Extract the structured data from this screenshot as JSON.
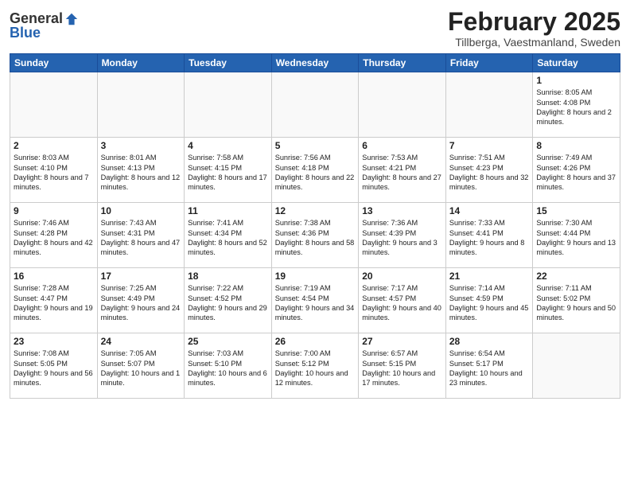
{
  "header": {
    "logo_general": "General",
    "logo_blue": "Blue",
    "month_title": "February 2025",
    "subtitle": "Tillberga, Vaestmanland, Sweden"
  },
  "weekdays": [
    "Sunday",
    "Monday",
    "Tuesday",
    "Wednesday",
    "Thursday",
    "Friday",
    "Saturday"
  ],
  "weeks": [
    [
      {
        "day": "",
        "info": ""
      },
      {
        "day": "",
        "info": ""
      },
      {
        "day": "",
        "info": ""
      },
      {
        "day": "",
        "info": ""
      },
      {
        "day": "",
        "info": ""
      },
      {
        "day": "",
        "info": ""
      },
      {
        "day": "1",
        "info": "Sunrise: 8:05 AM\nSunset: 4:08 PM\nDaylight: 8 hours and 2 minutes."
      }
    ],
    [
      {
        "day": "2",
        "info": "Sunrise: 8:03 AM\nSunset: 4:10 PM\nDaylight: 8 hours and 7 minutes."
      },
      {
        "day": "3",
        "info": "Sunrise: 8:01 AM\nSunset: 4:13 PM\nDaylight: 8 hours and 12 minutes."
      },
      {
        "day": "4",
        "info": "Sunrise: 7:58 AM\nSunset: 4:15 PM\nDaylight: 8 hours and 17 minutes."
      },
      {
        "day": "5",
        "info": "Sunrise: 7:56 AM\nSunset: 4:18 PM\nDaylight: 8 hours and 22 minutes."
      },
      {
        "day": "6",
        "info": "Sunrise: 7:53 AM\nSunset: 4:21 PM\nDaylight: 8 hours and 27 minutes."
      },
      {
        "day": "7",
        "info": "Sunrise: 7:51 AM\nSunset: 4:23 PM\nDaylight: 8 hours and 32 minutes."
      },
      {
        "day": "8",
        "info": "Sunrise: 7:49 AM\nSunset: 4:26 PM\nDaylight: 8 hours and 37 minutes."
      }
    ],
    [
      {
        "day": "9",
        "info": "Sunrise: 7:46 AM\nSunset: 4:28 PM\nDaylight: 8 hours and 42 minutes."
      },
      {
        "day": "10",
        "info": "Sunrise: 7:43 AM\nSunset: 4:31 PM\nDaylight: 8 hours and 47 minutes."
      },
      {
        "day": "11",
        "info": "Sunrise: 7:41 AM\nSunset: 4:34 PM\nDaylight: 8 hours and 52 minutes."
      },
      {
        "day": "12",
        "info": "Sunrise: 7:38 AM\nSunset: 4:36 PM\nDaylight: 8 hours and 58 minutes."
      },
      {
        "day": "13",
        "info": "Sunrise: 7:36 AM\nSunset: 4:39 PM\nDaylight: 9 hours and 3 minutes."
      },
      {
        "day": "14",
        "info": "Sunrise: 7:33 AM\nSunset: 4:41 PM\nDaylight: 9 hours and 8 minutes."
      },
      {
        "day": "15",
        "info": "Sunrise: 7:30 AM\nSunset: 4:44 PM\nDaylight: 9 hours and 13 minutes."
      }
    ],
    [
      {
        "day": "16",
        "info": "Sunrise: 7:28 AM\nSunset: 4:47 PM\nDaylight: 9 hours and 19 minutes."
      },
      {
        "day": "17",
        "info": "Sunrise: 7:25 AM\nSunset: 4:49 PM\nDaylight: 9 hours and 24 minutes."
      },
      {
        "day": "18",
        "info": "Sunrise: 7:22 AM\nSunset: 4:52 PM\nDaylight: 9 hours and 29 minutes."
      },
      {
        "day": "19",
        "info": "Sunrise: 7:19 AM\nSunset: 4:54 PM\nDaylight: 9 hours and 34 minutes."
      },
      {
        "day": "20",
        "info": "Sunrise: 7:17 AM\nSunset: 4:57 PM\nDaylight: 9 hours and 40 minutes."
      },
      {
        "day": "21",
        "info": "Sunrise: 7:14 AM\nSunset: 4:59 PM\nDaylight: 9 hours and 45 minutes."
      },
      {
        "day": "22",
        "info": "Sunrise: 7:11 AM\nSunset: 5:02 PM\nDaylight: 9 hours and 50 minutes."
      }
    ],
    [
      {
        "day": "23",
        "info": "Sunrise: 7:08 AM\nSunset: 5:05 PM\nDaylight: 9 hours and 56 minutes."
      },
      {
        "day": "24",
        "info": "Sunrise: 7:05 AM\nSunset: 5:07 PM\nDaylight: 10 hours and 1 minute."
      },
      {
        "day": "25",
        "info": "Sunrise: 7:03 AM\nSunset: 5:10 PM\nDaylight: 10 hours and 6 minutes."
      },
      {
        "day": "26",
        "info": "Sunrise: 7:00 AM\nSunset: 5:12 PM\nDaylight: 10 hours and 12 minutes."
      },
      {
        "day": "27",
        "info": "Sunrise: 6:57 AM\nSunset: 5:15 PM\nDaylight: 10 hours and 17 minutes."
      },
      {
        "day": "28",
        "info": "Sunrise: 6:54 AM\nSunset: 5:17 PM\nDaylight: 10 hours and 23 minutes."
      },
      {
        "day": "",
        "info": ""
      }
    ]
  ]
}
